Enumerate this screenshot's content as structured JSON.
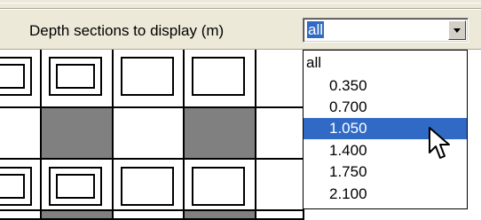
{
  "toolbar": {
    "label": "Depth sections to display (m)"
  },
  "depth_combo": {
    "value": "all",
    "button_icon": "chevron-down-icon"
  },
  "depth_dropdown": {
    "options": [
      "all",
      "0.350",
      "0.700",
      "1.050",
      "1.400",
      "1.750",
      "2.100"
    ],
    "highlighted": "1.050"
  },
  "colors": {
    "toolbar_bg": "#ece9d8",
    "selection": "#316ac5",
    "cell_gray": "#808080"
  },
  "cursor_icon": "arrow-pointer-icon"
}
